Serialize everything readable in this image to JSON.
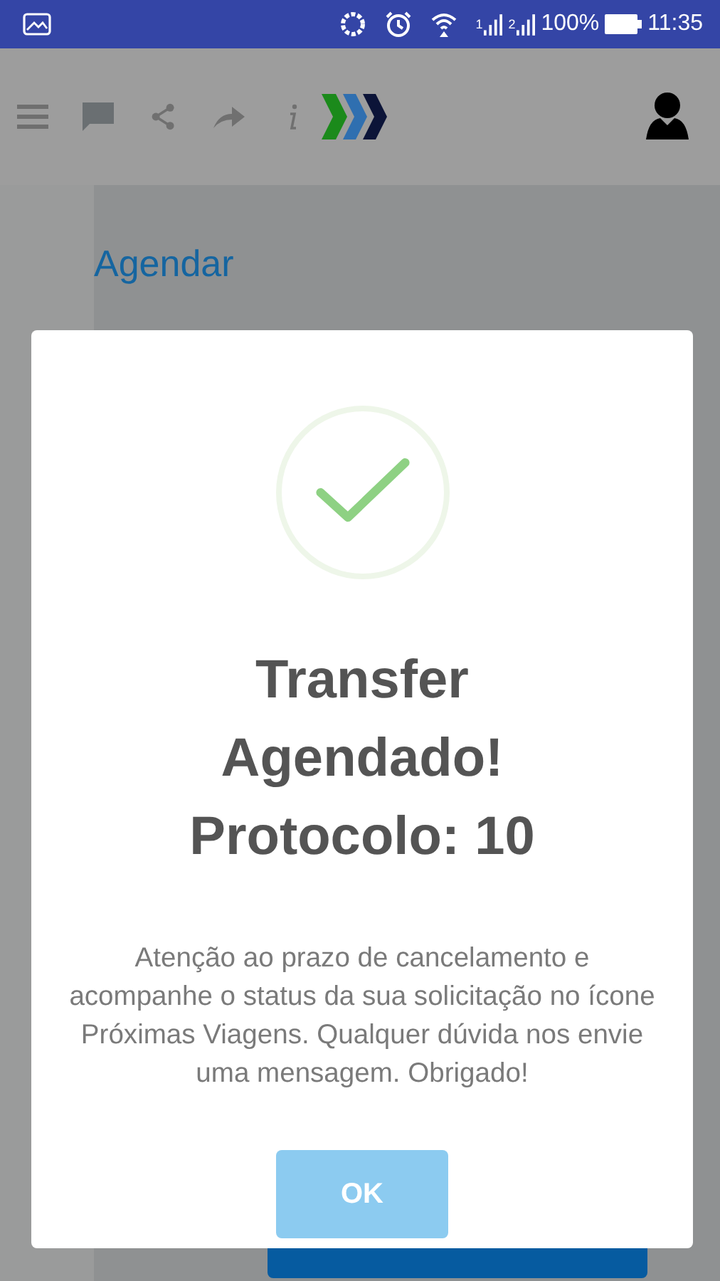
{
  "status_bar": {
    "sim_labels": [
      "1",
      "2"
    ],
    "battery_percent": "100%",
    "time": "11:35"
  },
  "page": {
    "title": "Agendar"
  },
  "dialog": {
    "title_lines": [
      "Transfer",
      "Agendado!",
      "Protocolo: 10"
    ],
    "message": "Atenção ao prazo de cancelamento e acompanhe o status da sua solicitação no ícone Próximas Viagens. Qualquer dúvida nos envie uma mensagem. Obrigado!",
    "button": "OK"
  }
}
